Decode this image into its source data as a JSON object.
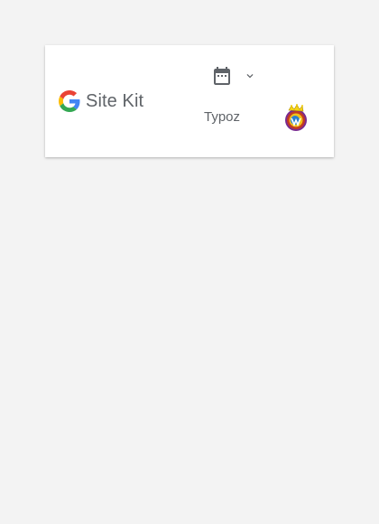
{
  "header": {
    "logo_text": "Site Kit",
    "logo_icon": "google-g-icon",
    "date_icon": "calendar-icon",
    "date_dropdown_icon": "chevron-down-icon",
    "user_name": "Typoz",
    "avatar_icon": "user-avatar"
  },
  "colors": {
    "page_background": "#f3f3f3",
    "card_background": "#ffffff",
    "text_gray": "#5f6368",
    "google_blue": "#4285F4",
    "google_red": "#EA4335",
    "google_yellow": "#FBBC05",
    "google_green": "#34A853"
  }
}
